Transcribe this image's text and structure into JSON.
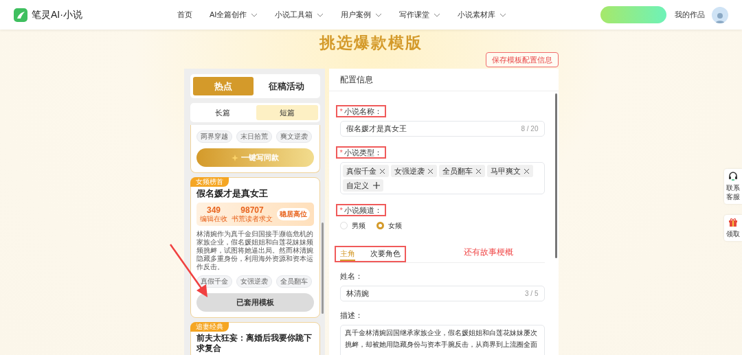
{
  "nav": {
    "logo": "笔灵AI·小说",
    "items": [
      {
        "label": "首页",
        "dropdown": false
      },
      {
        "label": "AI全篇创作",
        "dropdown": true
      },
      {
        "label": "小说工具箱",
        "dropdown": true
      },
      {
        "label": "用户案例",
        "dropdown": true
      },
      {
        "label": "写作课堂",
        "dropdown": true
      },
      {
        "label": "小说素材库",
        "dropdown": true
      }
    ],
    "my_works": "我的作品"
  },
  "page_title": "挑选爆款模版",
  "save_button": "保存模板配置信息",
  "left_panel": {
    "tabs": [
      {
        "label": "热点",
        "selected": true
      },
      {
        "label": "征稿活动",
        "selected": false
      }
    ],
    "subtabs": [
      {
        "label": "长篇",
        "selected": false
      },
      {
        "label": "短篇",
        "selected": true
      }
    ],
    "cards": [
      {
        "tags": [
          "两界穿越",
          "末日拾荒",
          "爽文逆袭"
        ],
        "button": {
          "label": "一键写同款",
          "kind": "write"
        }
      },
      {
        "badge": "女频榜首",
        "title": "假名媛才是真女王",
        "stats": [
          {
            "value": "349",
            "label": "编辑在收"
          },
          {
            "value": "98707",
            "label": "书荒读者求文"
          }
        ],
        "stats_badge": "稳居高位",
        "description": "林清婉作为真千金归国接手濒临危机的家族企业，假名媛姐姐和白莲花妹妹频频挑衅，试图将她逼出局。然而林清婉隐藏多重身份，利用海外资源和资本运作反击。",
        "tags": [
          "真假千金",
          "女强逆袭",
          "全员翻车"
        ],
        "button": {
          "label": "已套用模板",
          "kind": "applied"
        }
      },
      {
        "badge": "追妻经典",
        "title": "前夫太狂妄：离婚后我要你跪下求复合"
      }
    ]
  },
  "form": {
    "title": "配置信息",
    "fields": [
      {
        "kind": "text",
        "label": "小说名称：",
        "marker": "*",
        "annotated": true,
        "value": "假名媛才是真女王",
        "counter": "8 / 20"
      },
      {
        "kind": "tags",
        "label": "小说类型：",
        "marker": "*",
        "annotated": true,
        "tags": [
          "真假千金",
          "女强逆袭",
          "全员翻车",
          "马甲爽文"
        ],
        "add_label": "自定义"
      },
      {
        "kind": "radio",
        "label": "小说频道：",
        "marker": "*",
        "annotated": true,
        "options": [
          {
            "label": "男频",
            "selected": false
          },
          {
            "label": "女频",
            "selected": true
          }
        ]
      }
    ],
    "character_tabs": {
      "annotated": true,
      "tabs": [
        {
          "label": "主角",
          "selected": true
        },
        {
          "label": "次要角色",
          "selected": false
        }
      ],
      "note": "还有故事梗概"
    },
    "character_fields": [
      {
        "kind": "text",
        "label": "姓名：",
        "annotated": false,
        "value": "林清婉",
        "counter": "3 / 5"
      },
      {
        "kind": "textarea",
        "label": "描述：",
        "annotated": false,
        "value": "真千金林清婉回国继承家族企业，假名媛姐姐和白莲花妹妹屡次挑衅，却被她用隐藏身份与资本手腕反击，从商界到上流圈全面"
      }
    ]
  },
  "side_buttons": [
    {
      "label": "联系客服",
      "kind": "service"
    },
    {
      "label": "领取",
      "kind": "gift"
    }
  ]
}
